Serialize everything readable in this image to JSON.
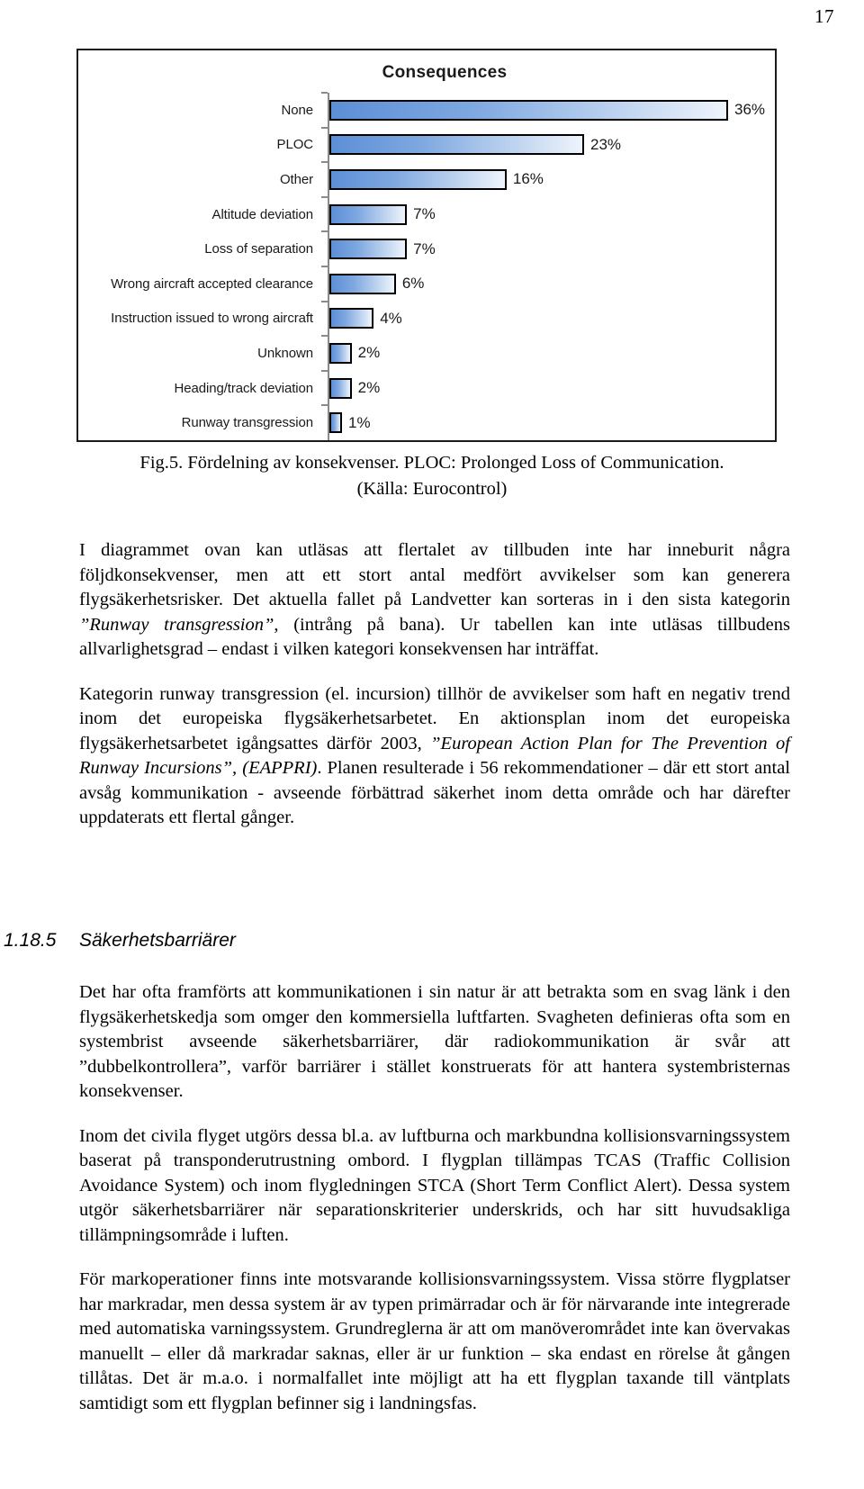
{
  "page": {
    "number": "17"
  },
  "figure": {
    "caption_line1": "Fig.5. Fördelning av konsekvenser. PLOC: Prolonged Loss of Communication.",
    "caption_line2": "(Källa: Eurocontrol)"
  },
  "chart_data": {
    "type": "bar",
    "orientation": "horizontal",
    "title": "Consequences",
    "xlabel": "",
    "ylabel": "",
    "xlim": [
      0,
      36
    ],
    "grid": false,
    "legend": false,
    "categories": [
      "None",
      "PLOC",
      "Other",
      "Altitude deviation",
      "Loss of separation",
      "Wrong aircraft accepted clearance",
      "Instruction issued to wrong aircraft",
      "Unknown",
      "Heading/track deviation",
      "Runway transgression"
    ],
    "values": [
      36,
      23,
      16,
      7,
      7,
      6,
      4,
      2,
      2,
      1
    ],
    "value_labels": [
      "36%",
      "23%",
      "16%",
      "7%",
      "7%",
      "6%",
      "4%",
      "2%",
      "2%",
      "1%"
    ],
    "bar_gradient_start": "#5d8fd6",
    "bar_gradient_end": "#eef4fc",
    "bar_outline": "#000000",
    "axis_color": "#8a8a8a"
  },
  "body": {
    "para1_a": "I diagrammet ovan kan utläsas att flertalet av tillbuden inte har inneburit några följdkonsekvenser, men att ett stort antal medfört avvikelser som kan generera flygsäkerhetsrisker. Det aktuella fallet på Landvetter kan sorteras in i den sista kategorin ",
    "para1_italic": "”Runway transgression”",
    "para1_b": ", (intrång på bana). Ur tabellen kan inte utläsas tillbudens allvarlighetsgrad – endast i vilken kategori konsekvensen har inträffat.",
    "para2_a": "Kategorin runway transgression (el. incursion) tillhör de avvikelser som haft en negativ trend inom det europeiska flygsäkerhetsarbetet. En aktionsplan inom det europeiska flygsäkerhetsarbetet igångsattes därför 2003, ",
    "para2_italic1": "”European Action Plan for The Prevention of Runway Incursions”,",
    "para2_italic2": "(EAPPRI)",
    "para2_b": ". Planen resulterade i 56 rekommendationer – där ett stort antal avsåg kommunikation - avseende förbättrad säkerhet inom detta område och har därefter uppdaterats ett flertal gånger.",
    "heading_number": "1.18.5",
    "heading_title": "Säkerhetsbarriärer",
    "para3": "Det har ofta framförts att kommunikationen i sin natur är att betrakta som en svag länk i den flygsäkerhetskedja som omger den kommersiella luftfarten. Svagheten definieras ofta som en systembrist avseende säkerhetsbarriärer, där radiokommunikation är svår att ”dubbelkontrollera”, varför barriärer i stället konstruerats för att hantera systembristernas konsekvenser.",
    "para4": "Inom det civila flyget utgörs dessa bl.a. av luftburna och markbundna kollisionsvarningssystem baserat på transponderutrustning ombord. I flygplan tillämpas TCAS (Traffic Collision Avoidance System) och inom flygledningen STCA (Short Term Conflict Alert). Dessa system utgör säkerhetsbarriärer när separationskriterier underskrids, och har sitt huvudsakliga tillämpningsområde i luften.",
    "para5": "För markoperationer finns inte motsvarande kollisionsvarningssystem. Vissa större flygplatser har markradar, men dessa system är av typen primärradar och är för närvarande inte integrerade med automatiska varningssystem. Grundreglerna är att om manöverområdet inte kan övervakas manuellt – eller då markradar saknas, eller är ur funktion – ska endast en rörelse åt gången tillåtas. Det är m.a.o. i normalfallet inte möjligt att ha ett flygplan taxande till väntplats samtidigt som ett flygplan befinner sig i landningsfas."
  }
}
